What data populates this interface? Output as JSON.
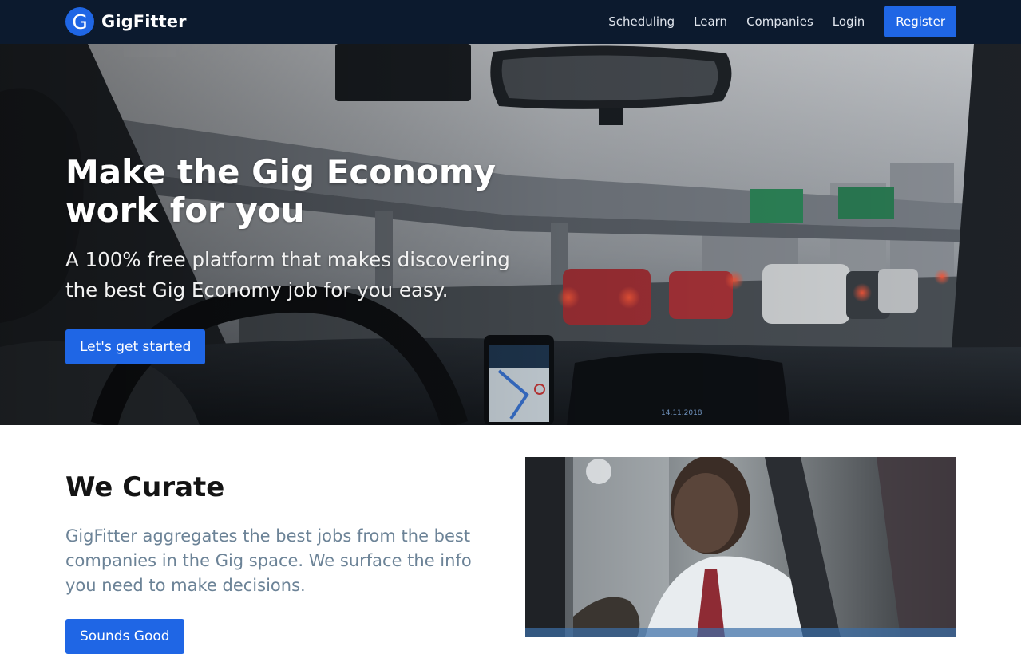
{
  "navbar": {
    "logo_letter": "G",
    "brand_name": "GigFitter",
    "links": [
      "Scheduling",
      "Learn",
      "Companies",
      "Login"
    ],
    "register_label": "Register",
    "background_color": "#0c1a2e",
    "accent_color": "#1f66e5"
  },
  "hero": {
    "title": "Make the Gig Economy work for you",
    "subtitle": "A 100% free platform that makes discovering the best Gig Economy job for you easy.",
    "cta_label": "Let's get started"
  },
  "curate": {
    "title": "We Curate",
    "text": "GigFitter aggregates the best jobs from the best companies in the Gig space. We surface the info you need to make decisions.",
    "cta_label": "Sounds Good"
  }
}
